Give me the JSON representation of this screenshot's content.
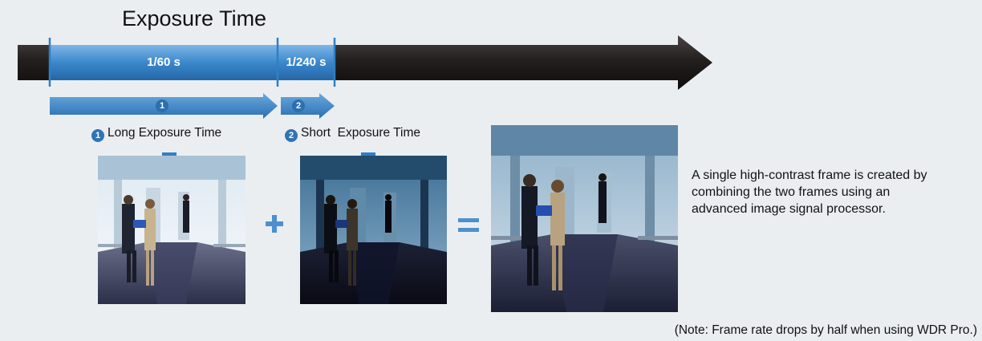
{
  "title": "Exposure Time",
  "segments": [
    {
      "label": "1/60 s"
    },
    {
      "label": "1/240 s"
    }
  ],
  "steps": [
    {
      "number": "1",
      "caption": "Long Exposure Time"
    },
    {
      "number": "2",
      "caption": "Short  Exposure Time"
    }
  ],
  "operators": {
    "plus": "+",
    "equals": "="
  },
  "description": "A single high-contrast frame is created by combining the two frames using an advanced image signal processor.",
  "note": "(Note: Frame rate drops by half when using WDR Pro.)",
  "colors": {
    "accent": "#2f7fc4",
    "dark": "#1c1a1a",
    "background": "#ebeef1"
  },
  "icons": [
    "plus-icon",
    "equals-icon",
    "down-arrow-icon"
  ]
}
